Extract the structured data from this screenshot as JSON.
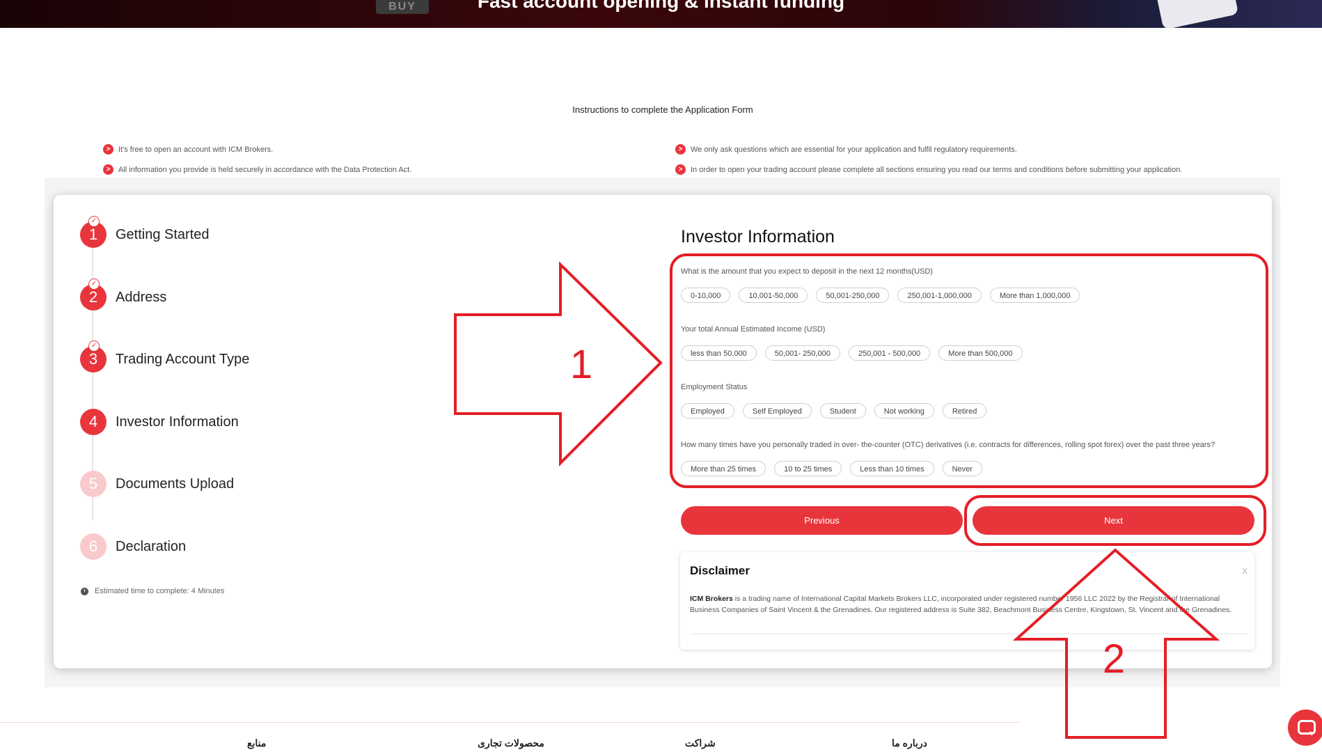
{
  "hero": {
    "title": "Fast account opening & instant funding",
    "buy_label": "BUY"
  },
  "instructions": {
    "title": "Instructions to complete the Application Form",
    "bullets_left": [
      "It's free to open an account with ICM Brokers.",
      "All information you provide is held securely in accordance with the Data Protection Act."
    ],
    "bullets_right": [
      "We only ask questions which are essential for your application and fulfil regulatory requirements.",
      "In order to open your trading account please complete all sections ensuring you read our terms and conditions before submitting your application."
    ]
  },
  "steps": [
    {
      "num": "1",
      "label": "Getting Started",
      "done": true
    },
    {
      "num": "2",
      "label": "Address",
      "done": true
    },
    {
      "num": "3",
      "label": "Trading Account Type",
      "done": true
    },
    {
      "num": "4",
      "label": "Investor Information",
      "done": false
    },
    {
      "num": "5",
      "label": "Documents Upload",
      "done": false
    },
    {
      "num": "6",
      "label": "Declaration",
      "done": false
    }
  ],
  "estimated_time": "Estimated time to complete: 4 Minutes",
  "form": {
    "title": "Investor Information",
    "questions": [
      {
        "label": "What is the amount that you expect to deposit in the next 12 months(USD)",
        "options": [
          "0-10,000",
          "10,001-50,000",
          "50,001-250,000",
          "250,001-1,000,000",
          "More than 1,000,000"
        ]
      },
      {
        "label": "Your total Annual Estimated Income (USD)",
        "options": [
          "less than 50,000",
          "50,001- 250,000",
          "250,001 - 500,000",
          "More than 500,000"
        ]
      },
      {
        "label": "Employment Status",
        "options": [
          "Employed",
          "Self Employed",
          "Student",
          "Not working",
          "Retired"
        ]
      },
      {
        "label": "How many times have you personally traded in over- the-counter (OTC) derivatives (i.e. contracts for differences, rolling spot forex) over the past three years?",
        "options": [
          "More than 25 times",
          "10 to 25 times",
          "Less than 10 times",
          "Never"
        ]
      }
    ],
    "previous_label": "Previous",
    "next_label": "Next"
  },
  "disclaimer": {
    "title": "Disclaimer",
    "close": "x",
    "brand": "ICM Brokers",
    "text": " is a trading name of International Capital Markets Brokers LLC, incorporated under registered number 1956 LLC 2022 by the Registrar of International Business Companies of Saint Vincent & the Grenadines. Our registered address is Suite 382, Beachmont Business Centre, Kingstown, St. Vincent and the Grenadines."
  },
  "annotations": {
    "label_1": "1",
    "label_2": "2",
    "color": "#e41e26"
  },
  "footer": {
    "links": [
      "منابع",
      "محصولات تجاری",
      "شراکت",
      "درباره ما"
    ]
  },
  "colors": {
    "accent": "#e8353c",
    "accent_light": "#f9c9cb"
  }
}
